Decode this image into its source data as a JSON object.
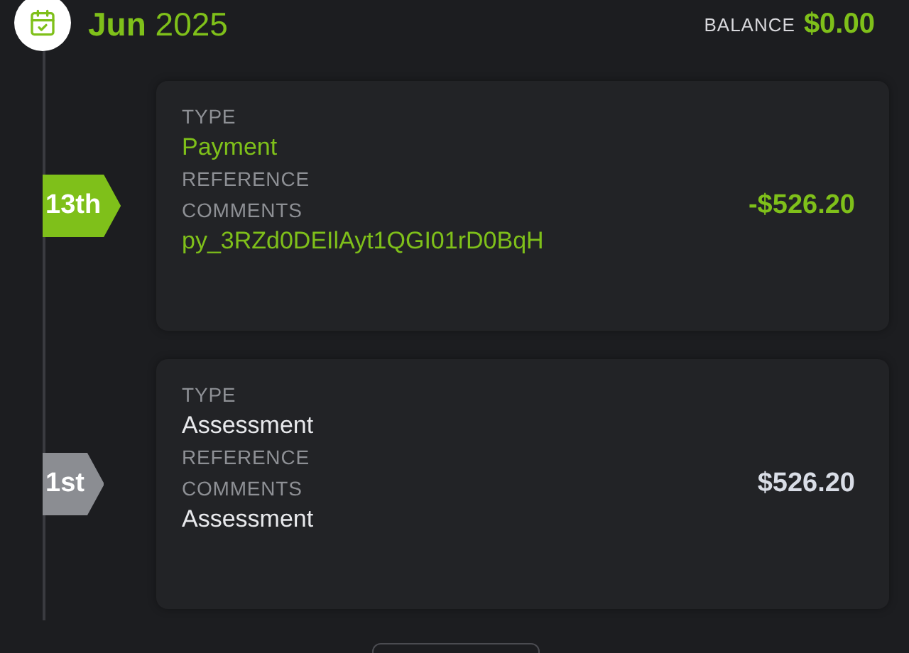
{
  "header": {
    "month": "Jun",
    "year": "2025",
    "balance_label": "BALANCE",
    "balance": "$0.00"
  },
  "entries": [
    {
      "kind": "payment",
      "date": "13th",
      "type_label": "TYPE",
      "type": "Payment",
      "reference_label": "REFERENCE",
      "comments_label": "COMMENTS",
      "comments": "py_3RZd0DEIlAyt1QGI01rD0BqH",
      "amount": "-$526.20"
    },
    {
      "kind": "assessment",
      "date": "1st",
      "type_label": "TYPE",
      "type": "Assessment",
      "reference_label": "REFERENCE",
      "comments_label": "COMMENTS",
      "comments": "Assessment",
      "amount": "$526.20"
    }
  ]
}
